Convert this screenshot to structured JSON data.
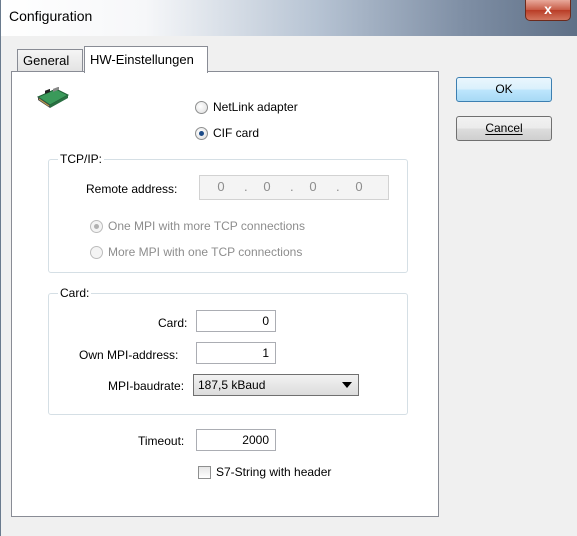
{
  "window": {
    "title": "Configuration",
    "close_label": "x"
  },
  "tabs": [
    {
      "label": "General",
      "active": false
    },
    {
      "label": "HW-Einstellungen",
      "active": true
    }
  ],
  "buttons": {
    "ok_label": "OK",
    "cancel_label": "Cancel",
    "cancel_mnemonic": "C"
  },
  "hardware": {
    "icon": "network-card-icon",
    "options": [
      {
        "label": "NetLink adapter",
        "checked": false
      },
      {
        "label": "CIF card",
        "checked": true
      }
    ]
  },
  "tcpip": {
    "title": "TCP/IP:",
    "remote_address_label": "Remote address:",
    "ip_parts": [
      "0",
      "0",
      "0",
      "0"
    ],
    "options": [
      {
        "label": "One MPI with more TCP connections",
        "checked": true
      },
      {
        "label": "More MPI with one TCP connections",
        "checked": false
      }
    ]
  },
  "card": {
    "title": "Card:",
    "card_label": "Card:",
    "card_value": "0",
    "own_mpi_label": "Own MPI-address:",
    "own_mpi_value": "1",
    "baudrate_label": "MPI-baudrate:",
    "baudrate_value": "187,5 kBaud"
  },
  "timeout": {
    "label": "Timeout:",
    "value": "2000"
  },
  "s7_string": {
    "label": "S7-String with header",
    "checked": false
  },
  "colors": {
    "selected_tab_bg": "#ffffff",
    "dialog_bg": "#f0f0f0",
    "disabled_text": "#8d8d8d"
  }
}
